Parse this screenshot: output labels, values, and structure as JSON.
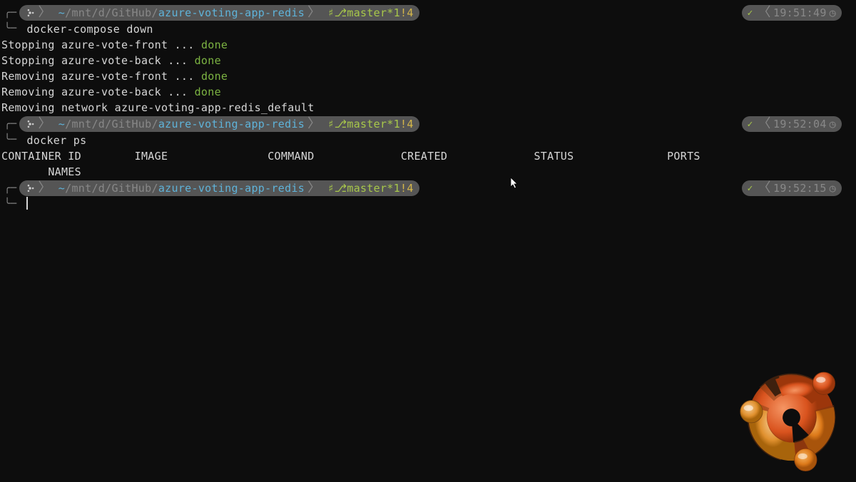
{
  "prompts": [
    {
      "time": "19:51:49"
    },
    {
      "time": "19:52:04"
    },
    {
      "time": "19:52:15"
    }
  ],
  "prompt": {
    "tilde": "~",
    "path1": "/mnt",
    "sep1": "/",
    "path2": "d",
    "sep2": "/",
    "path3": "GitHub",
    "sep3": "/",
    "repo": "azure-voting-app-redis",
    "branch": "master",
    "star": "*1",
    "bang": "!4"
  },
  "cmd1": "docker-compose down",
  "out": [
    {
      "pre": "Stopping azure-vote-front ... ",
      "tail": "done"
    },
    {
      "pre": "Stopping azure-vote-back  ... ",
      "tail": "done"
    },
    {
      "pre": "Removing azure-vote-front ... ",
      "tail": "done"
    },
    {
      "pre": "Removing azure-vote-back  ... ",
      "tail": "done"
    },
    {
      "pre": "Removing network azure-voting-app-redis_default",
      "tail": ""
    }
  ],
  "cmd2": "docker ps",
  "table_hdr1": "CONTAINER ID        IMAGE               COMMAND             CREATED             STATUS              PORTS",
  "table_hdr2": "       NAMES"
}
